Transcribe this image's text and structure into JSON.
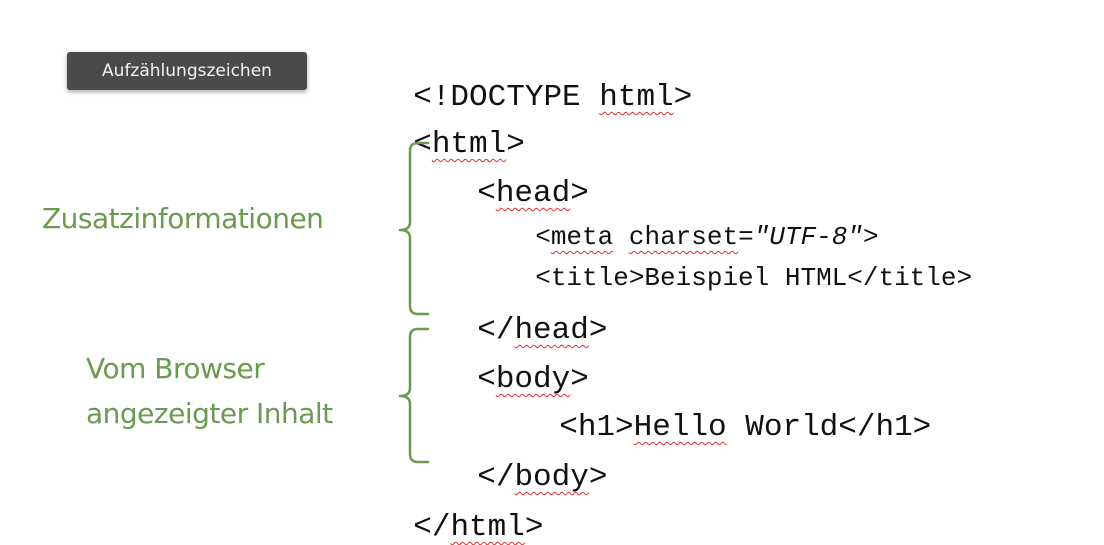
{
  "tooltip": {
    "text": "Aufzählungszeichen"
  },
  "code": {
    "doctype": {
      "prefix": "<!DOCTYPE ",
      "word": "html",
      "suffix": ">"
    },
    "html_open": {
      "prefix": "<",
      "word": "html",
      "suffix": ">"
    },
    "head_open": {
      "prefix": "<",
      "word": "head",
      "suffix": ">"
    },
    "meta": {
      "prefix": "<",
      "word1": "meta",
      "space": " ",
      "word2": "charset",
      "eq": "=",
      "value": "\"UTF-8\"",
      "suffix": ">"
    },
    "title": {
      "text": "<title>Beispiel HTML</title>"
    },
    "head_close": {
      "prefix": "</",
      "word": "head",
      "suffix": ">"
    },
    "body_open": {
      "prefix": "<",
      "word": "body",
      "suffix": ">"
    },
    "h1": {
      "prefix": "<h1>",
      "word": "Hello",
      "suffix": " World</h1>"
    },
    "body_close": {
      "prefix": "</",
      "word": "body",
      "suffix": ">"
    },
    "html_close": {
      "prefix": "</",
      "word": "html",
      "suffix": ">"
    }
  },
  "annotations": {
    "head_label": "Zusatzinformationen",
    "body_label_line1": "Vom Browser",
    "body_label_line2": "angezeigter Inhalt"
  },
  "colors": {
    "annotation_green": "#6a9b50",
    "spellcheck_red": "#e03030",
    "tooltip_bg": "#4a4a4a"
  }
}
